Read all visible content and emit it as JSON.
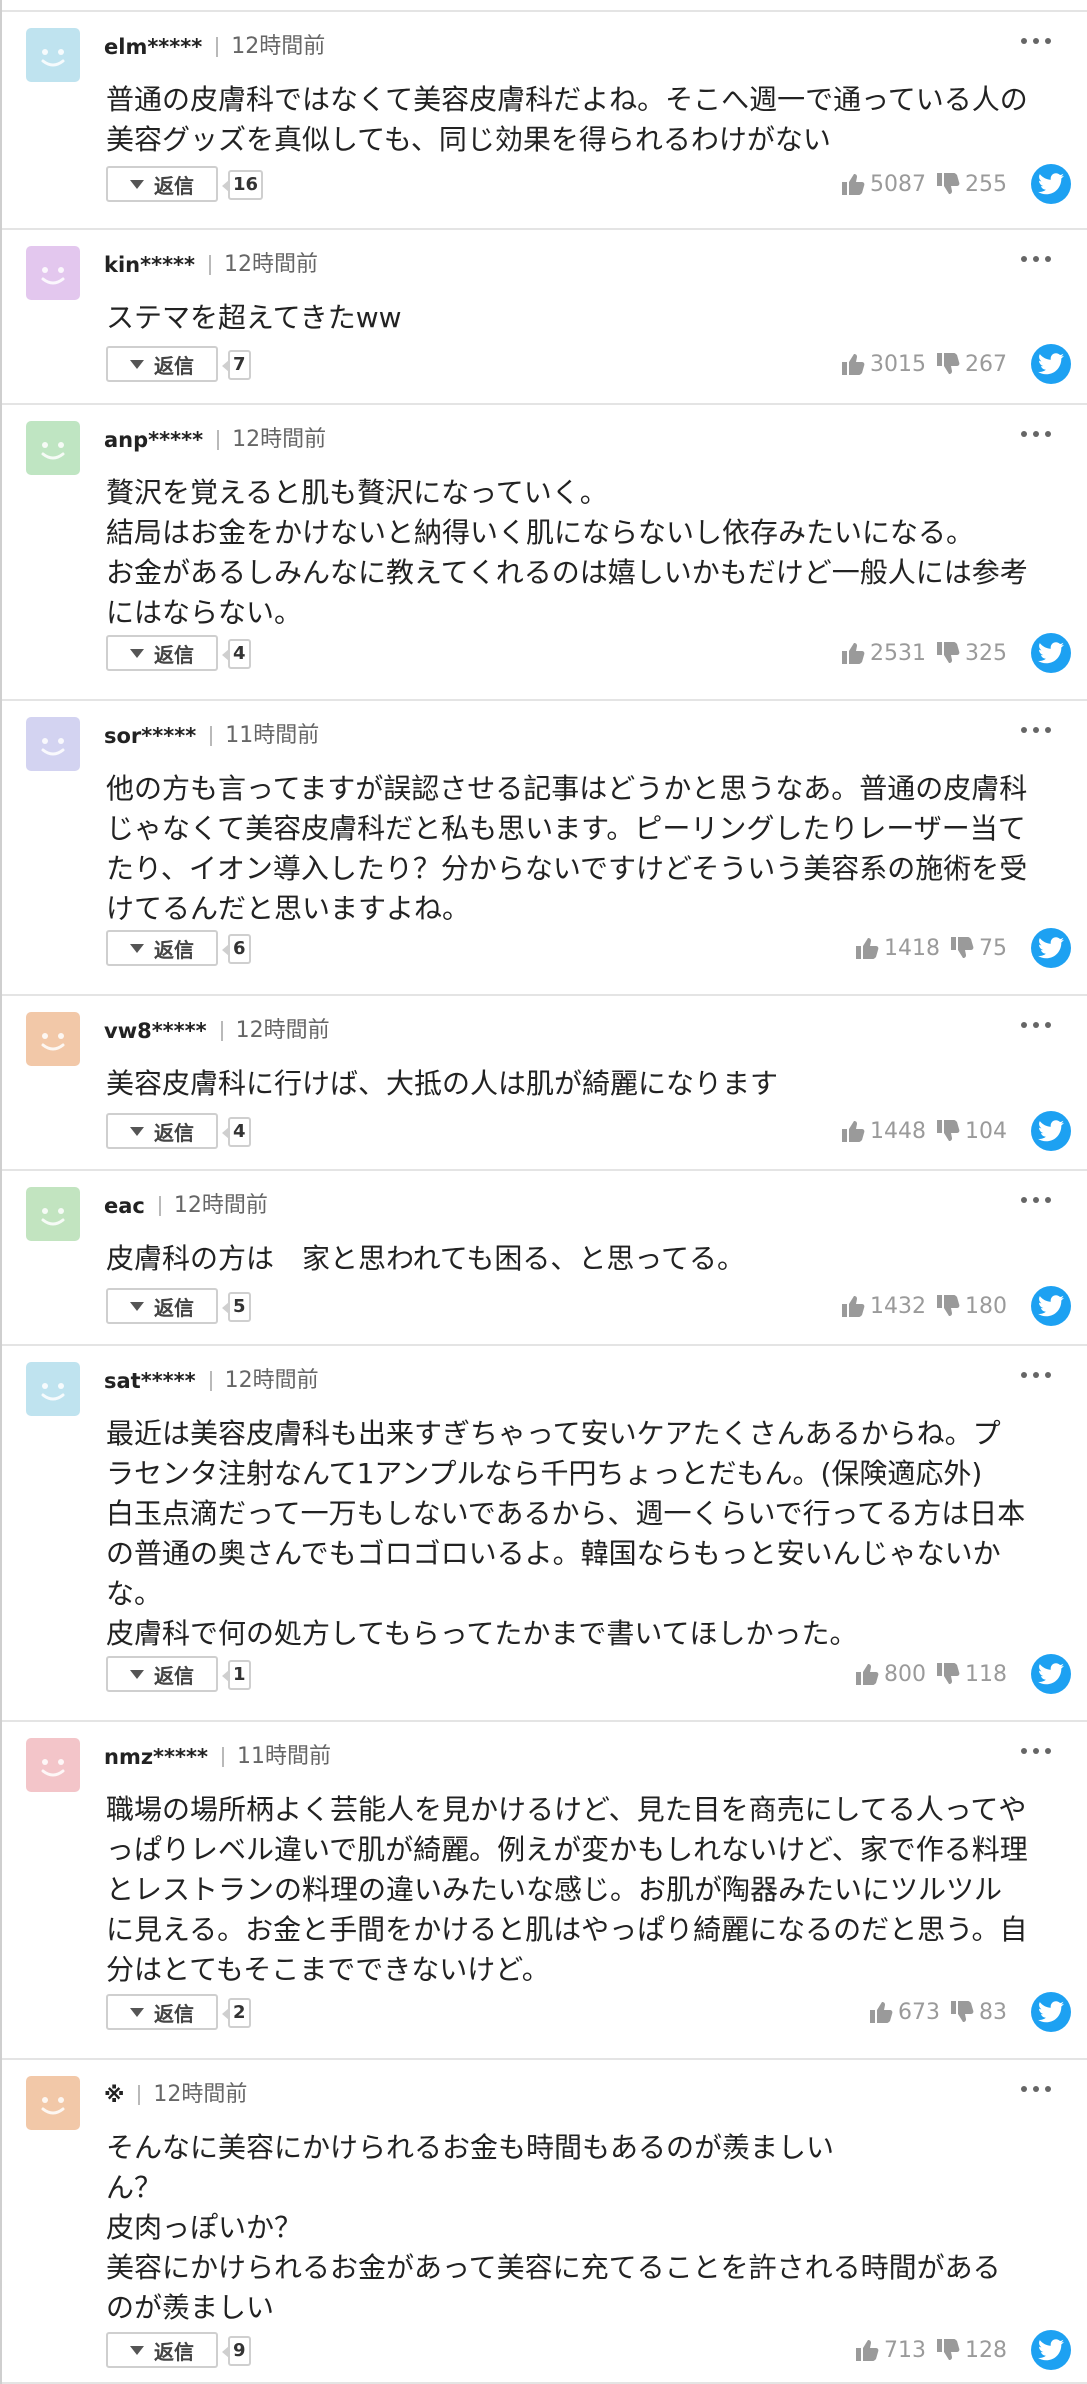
{
  "comments": [
    {
      "user": "elm*****",
      "time": "12時間前",
      "avatar_color": "#bfe3ef",
      "text": "普通の皮膚科ではなくて美容皮膚科だよね。そこへ週一で通っている人の\n美容グッズを真似しても、同じ効果を得られるわけがない",
      "reply_label": "返信",
      "replies": "16",
      "likes": "5087",
      "dislikes": "255"
    },
    {
      "user": "kin*****",
      "time": "12時間前",
      "avatar_color": "#e3c7ee",
      "text": "ステマを超えてきたww",
      "reply_label": "返信",
      "replies": "7",
      "likes": "3015",
      "dislikes": "267"
    },
    {
      "user": "anp*****",
      "time": "12時間前",
      "avatar_color": "#bfe5c2",
      "text": "贅沢を覚えると肌も贅沢になっていく。\n結局はお金をかけないと納得いく肌にならないし依存みたいになる。\nお金があるしみんなに教えてくれるのは嬉しいかもだけど一般人には参考\nにはならない。",
      "reply_label": "返信",
      "replies": "4",
      "likes": "2531",
      "dislikes": "325"
    },
    {
      "user": "sor*****",
      "time": "11時間前",
      "avatar_color": "#d3d3f1",
      "text": "他の方も言ってますが誤認させる記事はどうかと思うなあ。普通の皮膚科\nじゃなくて美容皮膚科だと私も思います。ピーリングしたりレーザー当て\nたり、イオン導入したり？分からないですけどそういう美容系の施術を受\nけてるんだと思いますよね。",
      "reply_label": "返信",
      "replies": "6",
      "likes": "1418",
      "dislikes": "75"
    },
    {
      "user": "vw8*****",
      "time": "12時間前",
      "avatar_color": "#f2c8a8",
      "text": "美容皮膚科に行けば、大抵の人は肌が綺麗になります",
      "reply_label": "返信",
      "replies": "4",
      "likes": "1448",
      "dislikes": "104"
    },
    {
      "user": "eac",
      "time": "12時間前",
      "avatar_color": "#c2e4c0",
      "text": "皮膚科の方は　家と思われても困る、と思ってる。",
      "reply_label": "返信",
      "replies": "5",
      "likes": "1432",
      "dislikes": "180"
    },
    {
      "user": "sat*****",
      "time": "12時間前",
      "avatar_color": "#bfe3ef",
      "text": "最近は美容皮膚科も出来すぎちゃって安いケアたくさんあるからね。プ\nラセンタ注射なんて1アンプルなら千円ちょっとだもん。(保険適応外)\n白玉点滴だって一万もしないであるから、週一くらいで行ってる方は日本\nの普通の奥さんでもゴロゴロいるよ。韓国ならもっと安いんじゃないか\nな。\n皮膚科で何の処方してもらってたかまで書いてほしかった。",
      "reply_label": "返信",
      "replies": "1",
      "likes": "800",
      "dislikes": "118"
    },
    {
      "user": "nmz*****",
      "time": "11時間前",
      "avatar_color": "#f3c5c9",
      "text": "職場の場所柄よく芸能人を見かけるけど、見た目を商売にしてる人ってや\nっぱりレベル違いで肌が綺麗。例えが変かもしれないけど、家で作る料理\nとレストランの料理の違いみたいな感じ。お肌が陶器みたいにツルツル\nに見える。お金と手間をかけると肌はやっぱり綺麗になるのだと思う。自\n分はとてもそこまでできないけど。",
      "reply_label": "返信",
      "replies": "2",
      "likes": "673",
      "dislikes": "83"
    },
    {
      "user": "※",
      "time": "12時間前",
      "avatar_color": "#f2c8a8",
      "text": "そんなに美容にかけられるお金も時間もあるのが羨ましい\nん？\n皮肉っぽいか？\n美容にかけられるお金があって美容に充てることを許される時間がある\nのが羨ましい",
      "reply_label": "返信",
      "replies": "9",
      "likes": "713",
      "dislikes": "128"
    }
  ]
}
